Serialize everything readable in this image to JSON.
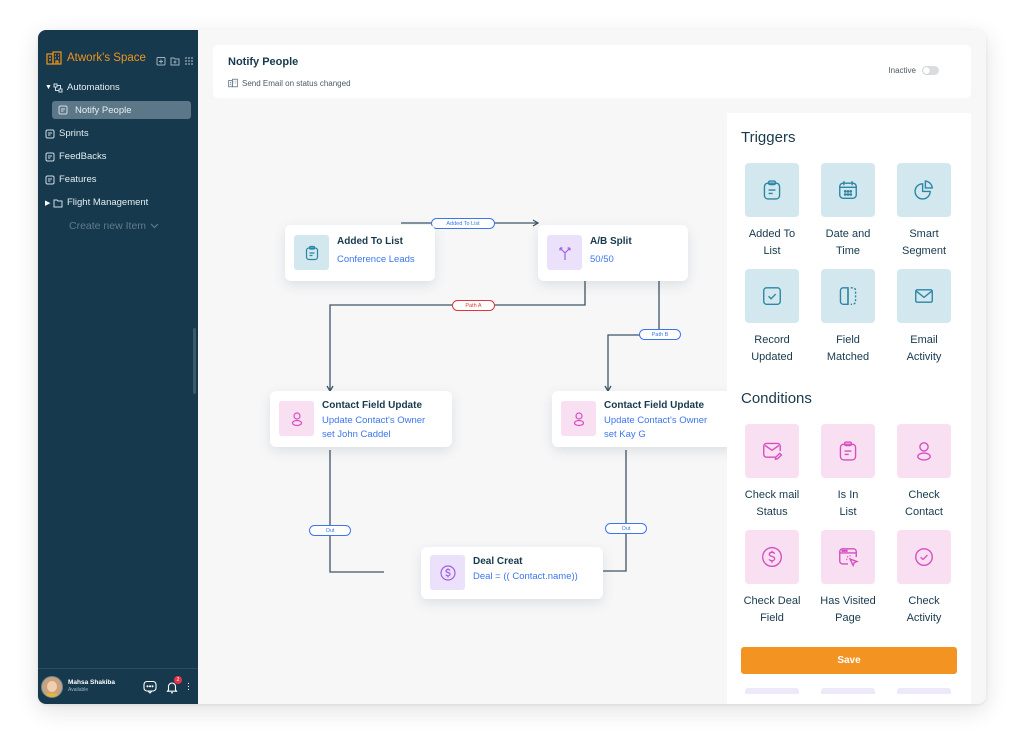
{
  "sidebar": {
    "space_name": "Atwork's Space",
    "items": [
      {
        "label": "Automations",
        "icon": "automation-icon",
        "expanded": true
      },
      {
        "label": "Notify People",
        "icon": "document-icon",
        "active": true
      },
      {
        "label": "Sprints",
        "icon": "document-icon"
      },
      {
        "label": "FeedBacks",
        "icon": "document-icon"
      },
      {
        "label": "Features",
        "icon": "document-icon"
      },
      {
        "label": "Flight Management",
        "icon": "folder-icon",
        "expanded": false
      }
    ],
    "create_new_label": "Create new Item",
    "user": {
      "name": "Mahsa Shakiba",
      "status": "Available",
      "notification_count": "2"
    }
  },
  "header": {
    "title": "Notify People",
    "subtitle": "Send Email on status changed",
    "status_label": "Inactive",
    "active": false
  },
  "flow": {
    "nodes": [
      {
        "id": "added-to-list",
        "title": "Added To List",
        "lines": [
          "Conference Leads"
        ],
        "icon": "clipboard-icon",
        "color": "#d3e7ef"
      },
      {
        "id": "ab-split",
        "title": "A/B Split",
        "lines": [
          "50/50"
        ],
        "icon": "split-icon",
        "color": "#ece1fb"
      },
      {
        "id": "contact-update-a",
        "title": "Contact Field Update",
        "lines": [
          "Update Contact's Owner",
          "set John Caddel"
        ],
        "icon": "user-icon",
        "color": "#f8dff1"
      },
      {
        "id": "contact-update-b",
        "title": "Contact Field Update",
        "lines": [
          "Update Contact's Owner",
          "set Kay G"
        ],
        "icon": "user-icon",
        "color": "#f8dff1"
      },
      {
        "id": "deal-create",
        "title": "Deal Creat",
        "lines": [
          "Deal = (( Contact.name))"
        ],
        "icon": "dollar-icon",
        "color": "#ece1fb"
      }
    ],
    "edge_labels": {
      "added": "Added To List",
      "path_a": "Path A",
      "path_b": "Path B",
      "out_a": "Out",
      "out_b": "Out"
    },
    "colors": {
      "line": "#3e5566",
      "label_blue": "#3c76ee",
      "label_red": "#e0353d"
    }
  },
  "panel": {
    "triggers_title": "Triggers",
    "triggers": [
      {
        "label1": "Added To",
        "label2": "List",
        "icon": "clipboard-icon"
      },
      {
        "label1": "Date and",
        "label2": "Time",
        "icon": "calendar-icon"
      },
      {
        "label1": "Smart",
        "label2": "Segment",
        "icon": "pie-chart-icon"
      },
      {
        "label1": "Record",
        "label2": "Updated",
        "icon": "checkbox-icon"
      },
      {
        "label1": "Field",
        "label2": "Matched",
        "icon": "field-match-icon"
      },
      {
        "label1": "Email",
        "label2": "Activity",
        "icon": "mail-icon"
      }
    ],
    "conditions_title": "Conditions",
    "conditions": [
      {
        "label1": "Check mail",
        "label2": "Status",
        "icon": "mail-edit-icon"
      },
      {
        "label1": "Is In",
        "label2": "List",
        "icon": "clipboard-icon"
      },
      {
        "label1": "Check",
        "label2": "Contact",
        "icon": "user-icon"
      },
      {
        "label1": "Check Deal",
        "label2": "Field",
        "icon": "dollar-icon"
      },
      {
        "label1": "Has Visited",
        "label2": "Page",
        "icon": "browser-click-icon"
      },
      {
        "label1": "Check",
        "label2": "Activity",
        "icon": "check-circle-icon"
      }
    ],
    "save_label": "Save",
    "colors": {
      "accent": "#f39322",
      "trigger_bg": "#d3e7ef",
      "condition_bg": "#f8dff1"
    }
  }
}
